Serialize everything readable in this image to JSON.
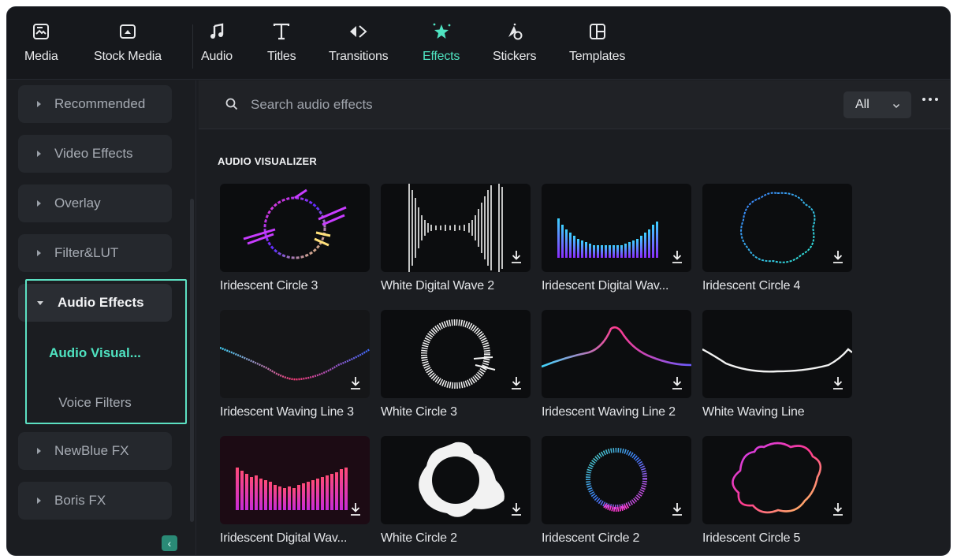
{
  "toolbar": {
    "tabs": [
      {
        "label": "Media",
        "icon": "media-icon"
      },
      {
        "label": "Stock Media",
        "icon": "stock-media-icon"
      },
      {
        "label": "Audio",
        "icon": "music-note-icon"
      },
      {
        "label": "Titles",
        "icon": "titles-t-icon"
      },
      {
        "label": "Transitions",
        "icon": "transitions-icon"
      },
      {
        "label": "Effects",
        "icon": "effects-star-icon",
        "active": true
      },
      {
        "label": "Stickers",
        "icon": "stickers-icon"
      },
      {
        "label": "Templates",
        "icon": "templates-icon"
      }
    ]
  },
  "sidebar": {
    "items": [
      {
        "label": "Recommended"
      },
      {
        "label": "Video Effects"
      },
      {
        "label": "Overlay"
      },
      {
        "label": "Filter&LUT"
      },
      {
        "label": "Audio Effects",
        "expanded": true
      },
      {
        "label": "NewBlue FX"
      },
      {
        "label": "Boris FX"
      }
    ],
    "subitems": [
      {
        "label": "Audio Visual...",
        "active": true
      },
      {
        "label": "Voice Filters"
      }
    ],
    "collapse_glyph": "‹"
  },
  "search": {
    "placeholder": "Search audio effects",
    "filter_value": "All"
  },
  "section": {
    "title": "AUDIO VISUALIZER"
  },
  "effects": [
    {
      "name": "Iridescent Circle 3"
    },
    {
      "name": "White  Digital Wave 2"
    },
    {
      "name": "Iridescent Digital Wav..."
    },
    {
      "name": "Iridescent Circle 4"
    },
    {
      "name": "Iridescent Waving Line 3"
    },
    {
      "name": "White Circle 3"
    },
    {
      "name": "Iridescent Waving Line 2"
    },
    {
      "name": "White Waving Line"
    },
    {
      "name": "Iridescent Digital Wav..."
    },
    {
      "name": "White Circle 2"
    },
    {
      "name": "Iridescent Circle 2"
    },
    {
      "name": "Iridescent Circle 5"
    }
  ],
  "colors": {
    "accent": "#4fe3c1",
    "highlight_border": "#5ce0c2",
    "background": "#1b1d21"
  }
}
